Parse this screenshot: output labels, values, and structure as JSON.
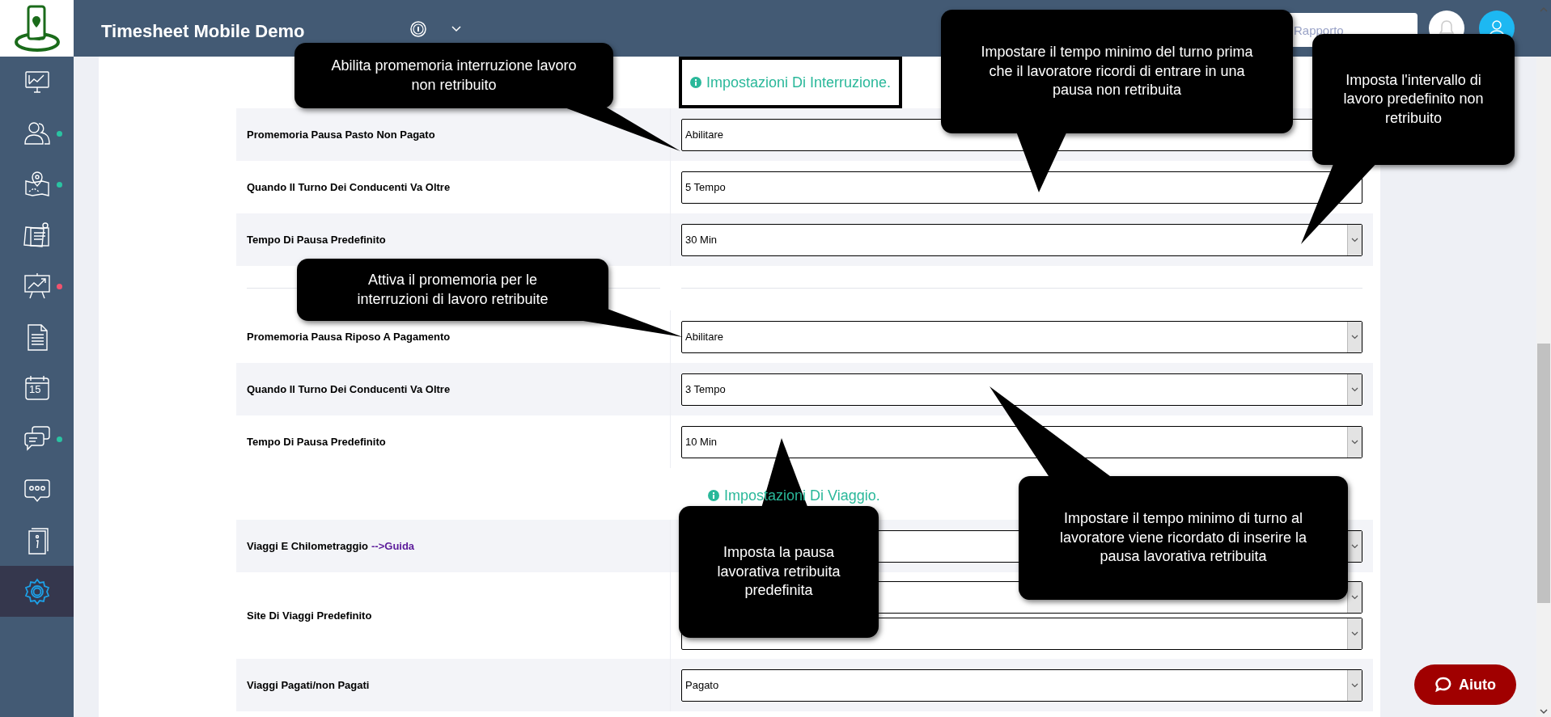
{
  "header": {
    "title": "Timesheet Mobile Demo",
    "search": {
      "placeholder": "Rapporto"
    }
  },
  "sidebar": {
    "items": [
      {
        "kind": "monitor",
        "selected": false
      },
      {
        "kind": "users",
        "selected": false,
        "color": "#2ac3a2"
      },
      {
        "kind": "map",
        "selected": false,
        "color": "#2ac3a2"
      },
      {
        "kind": "notes",
        "selected": false
      },
      {
        "kind": "chart",
        "selected": false,
        "color": "#f1536e"
      },
      {
        "kind": "document",
        "selected": false
      },
      {
        "kind": "calendar",
        "selected": false,
        "label": "15"
      },
      {
        "kind": "chat",
        "selected": false,
        "color": "#2ac3a2"
      },
      {
        "kind": "message",
        "selected": false
      },
      {
        "kind": "book",
        "selected": false
      },
      {
        "kind": "settings",
        "selected": true
      }
    ]
  },
  "settings": {
    "rows": [
      {
        "kind": "heading",
        "text": "Impostazioni Di Interruzione.",
        "highlighted": true
      },
      {
        "kind": "field",
        "label": "Promemoria Pausa Pasto Non Pagato",
        "fields": [
          {
            "kind": "input",
            "value": "Abilitare"
          }
        ]
      },
      {
        "kind": "field",
        "label": "Quando Il Turno Dei Conducenti Va Oltre",
        "fields": [
          {
            "kind": "input",
            "value": "5 Tempo"
          }
        ]
      },
      {
        "kind": "field",
        "label": "Tempo Di Pausa Predefinito",
        "fields": [
          {
            "kind": "select",
            "value": "30 Min"
          }
        ]
      },
      {
        "kind": "divider"
      },
      {
        "kind": "field",
        "label": "Promemoria Pausa Riposo A Pagamento",
        "fields": [
          {
            "kind": "select",
            "value": "Abilitare"
          }
        ]
      },
      {
        "kind": "field",
        "label": "Quando Il Turno Dei Conducenti Va Oltre",
        "fields": [
          {
            "kind": "select",
            "value": "3 Tempo"
          }
        ]
      },
      {
        "kind": "field",
        "label": "Tempo Di Pausa Predefinito",
        "fields": [
          {
            "kind": "select",
            "value": "10 Min"
          }
        ]
      },
      {
        "kind": "heading",
        "text": "Impostazioni Di Viaggio.",
        "highlighted": false
      },
      {
        "kind": "field",
        "label": "Viaggi E Chilometraggio",
        "link": "-->Guida",
        "fields": [
          {
            "kind": "select"
          }
        ]
      },
      {
        "kind": "field",
        "label": "Site Di Viaggi Predefinito",
        "fields": [
          {
            "kind": "select"
          },
          {
            "kind": "select"
          }
        ]
      },
      {
        "kind": "field",
        "label": "Viaggi Pagati/non Pagati",
        "fields": [
          {
            "kind": "select",
            "value": "Pagato"
          }
        ]
      }
    ]
  },
  "callouts": [
    {
      "text": "Abilita promemoria interruzione lavoro non retribuito"
    },
    {
      "text": "Impostare il tempo minimo del turno prima che il lavoratore ricordi di entrare in una pausa non retribuita"
    },
    {
      "text": "Imposta l'intervallo di lavoro predefinito non retribuito"
    },
    {
      "text": "Attiva il promemoria per le interruzioni di lavoro retribuite"
    },
    {
      "text": "Imposta la pausa lavorativa retribuita predefinita"
    },
    {
      "text": "Impostare il tempo minimo di turno al lavoratore viene ricordato di inserire la pausa lavorativa retribuita"
    }
  ],
  "help_button": {
    "label": "Aiuto"
  }
}
